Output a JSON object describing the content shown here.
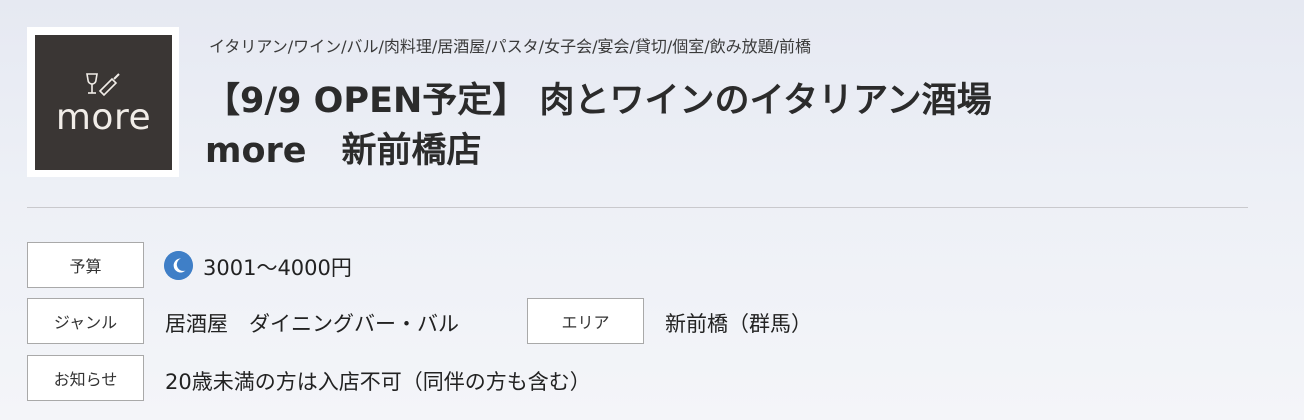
{
  "shop": {
    "logo_text": "more",
    "logo_icon": "wine-glass-bottle-icon",
    "genre_tags": "イタリアン/ワイン/バル/肉料理/居酒屋/パスタ/女子会/宴会/貸切/個室/飲み放題/前橋",
    "title_line1": "【9/9 OPEN予定】 肉とワインのイタリアン酒場",
    "title_line2": "more　新前橋店"
  },
  "info": {
    "budget_label": "予算",
    "budget_icon": "dinner-moon-icon",
    "budget_value": "3001～4000円",
    "genre_label": "ジャンル",
    "genre_value": "居酒屋　ダイニングバー・バル",
    "area_label": "エリア",
    "area_value": "新前橋（群馬）",
    "notice_label": "お知らせ",
    "notice_value": "20歳未満の方は入店不可（同伴の方も含む）"
  },
  "colors": {
    "logo_bg": "#3a3634",
    "budget_icon": "#3f7fc7"
  }
}
